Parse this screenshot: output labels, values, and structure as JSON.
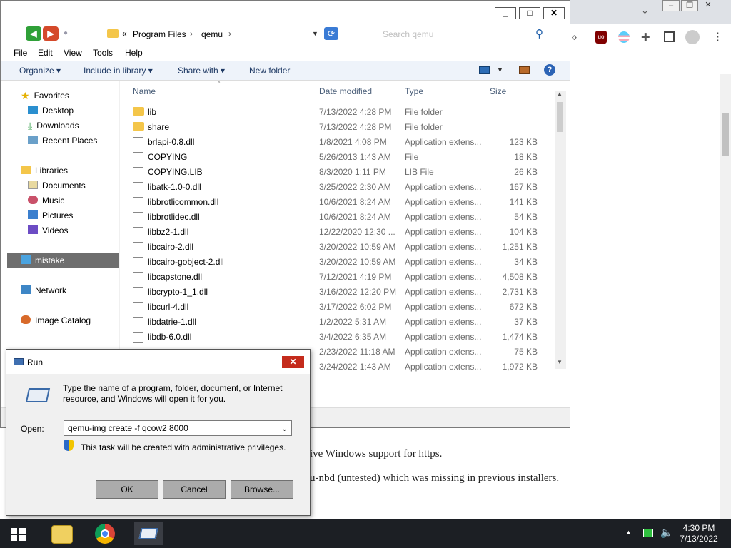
{
  "browser": {
    "content_lines": [
      "ive Windows support for https.",
      "u-nbd (untested) which was missing in previous installers."
    ]
  },
  "explorer": {
    "breadcrumb": [
      "«",
      "Program Files",
      "›",
      "qemu",
      "›"
    ],
    "search_placeholder": "Search qemu",
    "menu": [
      "File",
      "Edit",
      "View",
      "Tools",
      "Help"
    ],
    "commands": {
      "organize": "Organize",
      "include": "Include in library",
      "share": "Share with",
      "new_folder": "New folder"
    },
    "nav": {
      "favorites": "Favorites",
      "desktop": "Desktop",
      "downloads": "Downloads",
      "recent": "Recent Places",
      "libraries": "Libraries",
      "documents": "Documents",
      "music": "Music",
      "pictures": "Pictures",
      "videos": "Videos",
      "computer": "mistake",
      "network": "Network",
      "image_catalog": "Image Catalog"
    },
    "columns": {
      "name": "Name",
      "date": "Date modified",
      "type": "Type",
      "size": "Size"
    },
    "files": [
      {
        "name": "lib",
        "date": "7/13/2022 4:28 PM",
        "type": "File folder",
        "size": "",
        "kind": "folder"
      },
      {
        "name": "share",
        "date": "7/13/2022 4:28 PM",
        "type": "File folder",
        "size": "",
        "kind": "folder"
      },
      {
        "name": "brlapi-0.8.dll",
        "date": "1/8/2021 4:08 PM",
        "type": "Application extens...",
        "size": "123 KB",
        "kind": "dll"
      },
      {
        "name": "COPYING",
        "date": "5/26/2013 1:43 AM",
        "type": "File",
        "size": "18 KB",
        "kind": "file"
      },
      {
        "name": "COPYING.LIB",
        "date": "8/3/2020 1:11 PM",
        "type": "LIB File",
        "size": "26 KB",
        "kind": "file"
      },
      {
        "name": "libatk-1.0-0.dll",
        "date": "3/25/2022 2:30 AM",
        "type": "Application extens...",
        "size": "167 KB",
        "kind": "dll"
      },
      {
        "name": "libbrotlicommon.dll",
        "date": "10/6/2021 8:24 AM",
        "type": "Application extens...",
        "size": "141 KB",
        "kind": "dll"
      },
      {
        "name": "libbrotlidec.dll",
        "date": "10/6/2021 8:24 AM",
        "type": "Application extens...",
        "size": "54 KB",
        "kind": "dll"
      },
      {
        "name": "libbz2-1.dll",
        "date": "12/22/2020 12:30 ...",
        "type": "Application extens...",
        "size": "104 KB",
        "kind": "dll"
      },
      {
        "name": "libcairo-2.dll",
        "date": "3/20/2022 10:59 AM",
        "type": "Application extens...",
        "size": "1,251 KB",
        "kind": "dll"
      },
      {
        "name": "libcairo-gobject-2.dll",
        "date": "3/20/2022 10:59 AM",
        "type": "Application extens...",
        "size": "34 KB",
        "kind": "dll"
      },
      {
        "name": "libcapstone.dll",
        "date": "7/12/2021 4:19 PM",
        "type": "Application extens...",
        "size": "4,508 KB",
        "kind": "dll"
      },
      {
        "name": "libcrypto-1_1.dll",
        "date": "3/16/2022 12:20 PM",
        "type": "Application extens...",
        "size": "2,731 KB",
        "kind": "dll"
      },
      {
        "name": "libcurl-4.dll",
        "date": "3/17/2022 6:02 PM",
        "type": "Application extens...",
        "size": "672 KB",
        "kind": "dll"
      },
      {
        "name": "libdatrie-1.dll",
        "date": "1/2/2022 5:31 AM",
        "type": "Application extens...",
        "size": "37 KB",
        "kind": "dll"
      },
      {
        "name": "libdb-6.0.dll",
        "date": "3/4/2022 6:35 AM",
        "type": "Application extens...",
        "size": "1,474 KB",
        "kind": "dll"
      },
      {
        "name": "",
        "date": "2/23/2022 11:18 AM",
        "type": "Application extens...",
        "size": "75 KB",
        "kind": "dll"
      },
      {
        "name": "",
        "date": "3/24/2022 1:43 AM",
        "type": "Application extens...",
        "size": "1,972 KB",
        "kind": "dll"
      }
    ]
  },
  "run": {
    "title": "Run",
    "description": "Type the name of a program, folder, document, or Internet resource, and Windows will open it for you.",
    "open_label": "Open:",
    "open_value": "qemu-img create -f qcow2 8000",
    "admin_note": "This task will be created with administrative privileges.",
    "ok": "OK",
    "cancel": "Cancel",
    "browse": "Browse..."
  },
  "taskbar": {
    "time": "4:30 PM",
    "date": "7/13/2022"
  }
}
